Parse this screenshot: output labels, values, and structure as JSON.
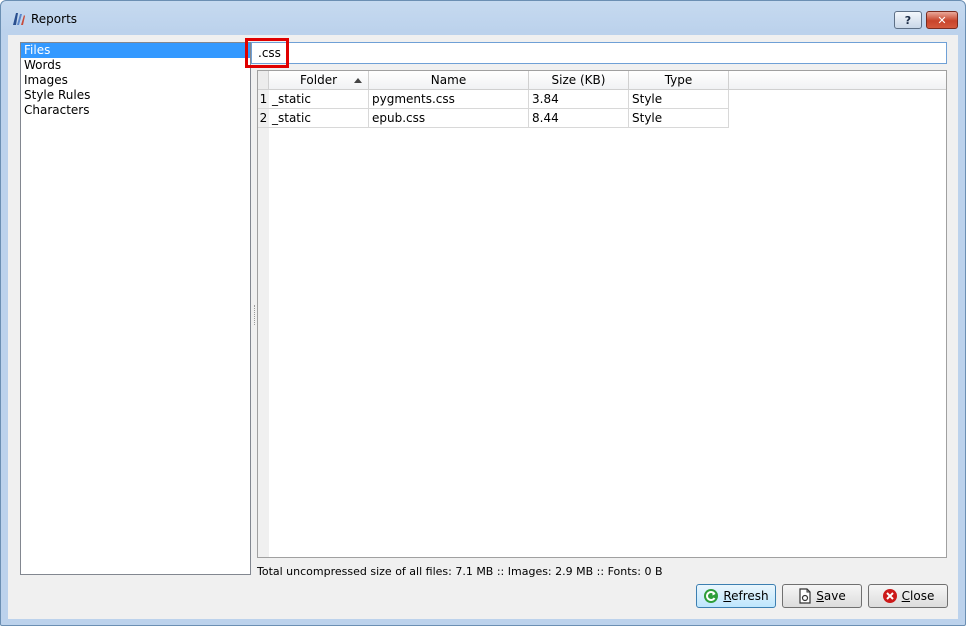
{
  "window": {
    "title": "Reports",
    "help_label": "?",
    "close_label": "✕"
  },
  "categories": [
    "Files",
    "Words",
    "Images",
    "Style Rules",
    "Characters"
  ],
  "filter": {
    "value": ".css"
  },
  "table": {
    "columns": [
      "Folder",
      "Name",
      "Size (KB)",
      "Type"
    ],
    "rows": [
      {
        "num": "1",
        "folder": "_static",
        "name": "pygments.css",
        "size": "3.84",
        "type": "Style"
      },
      {
        "num": "2",
        "folder": "_static",
        "name": "epub.css",
        "size": "8.44",
        "type": "Style"
      }
    ]
  },
  "status": "Total uncompressed size of all files: 7.1 MB :: Images: 2.9 MB :: Fonts: 0 B",
  "buttons": {
    "refresh": {
      "mnemonic": "R",
      "rest": "efresh"
    },
    "save": {
      "mnemonic": "S",
      "rest": "ave"
    },
    "close": {
      "mnemonic": "C",
      "rest": "lose"
    }
  },
  "colors": {
    "selection": "#3399ff",
    "highlight_box": "#e00000",
    "refresh_icon": "#2e9e3a",
    "close_icon": "#cc1a1a"
  }
}
